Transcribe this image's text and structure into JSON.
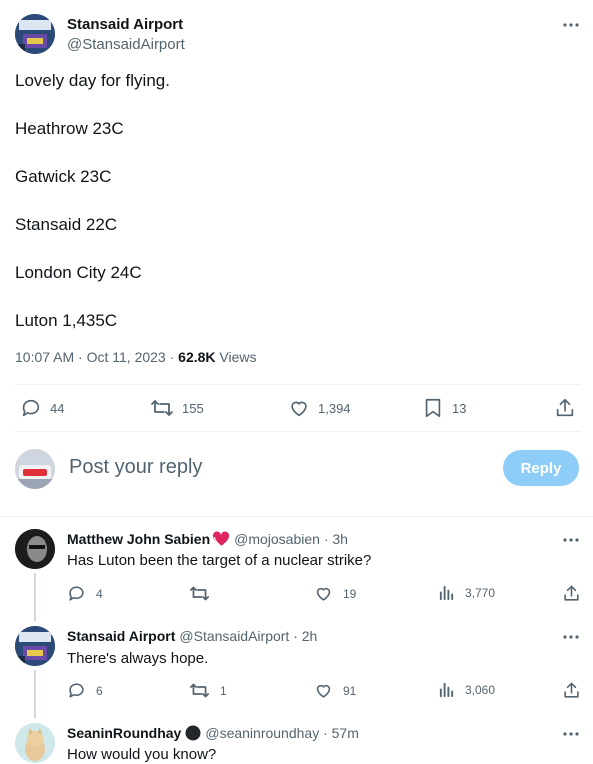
{
  "author": {
    "name": "Stansaid Airport",
    "handle": "@StansaidAirport"
  },
  "tweet": {
    "lines": [
      "Lovely day for flying.",
      "Heathrow 23C",
      "Gatwick 23C",
      "Stansaid 22C",
      "London City 24C",
      "Luton 1,435C"
    ],
    "time": "10:07 AM · Oct 11, 2023 · ",
    "views_count": "62.8K",
    "views_label": " Views"
  },
  "actions": {
    "replies": "44",
    "retweets": "155",
    "likes": "1,394",
    "bookmarks": "13"
  },
  "compose": {
    "placeholder": "Post your reply",
    "button": "Reply"
  },
  "replies": [
    {
      "name": "Matthew John Sabien",
      "handle": "@mojosabien · 3h",
      "text": "Has Luton been the target of a nuclear strike?",
      "replies": "4",
      "retweets": "",
      "likes": "19",
      "views": "3,770"
    },
    {
      "name": "Stansaid Airport",
      "handle": "@StansaidAirport · 2h",
      "text": "There's always hope.",
      "replies": "6",
      "retweets": "1",
      "likes": "91",
      "views": "3,060"
    },
    {
      "name": "SeaninRoundhay",
      "handle": "@seaninroundhay · 57m",
      "text": "How would you know?"
    }
  ],
  "icons": {
    "more": "more-icon",
    "reply": "reply-icon",
    "retweet": "retweet-icon",
    "like": "heart-icon",
    "bookmark": "bookmark-icon",
    "share": "share-icon",
    "views": "views-icon"
  },
  "colors": {
    "accent": "#1d9bf0",
    "reply_button": "#8ecdf8",
    "muted": "#536471"
  }
}
